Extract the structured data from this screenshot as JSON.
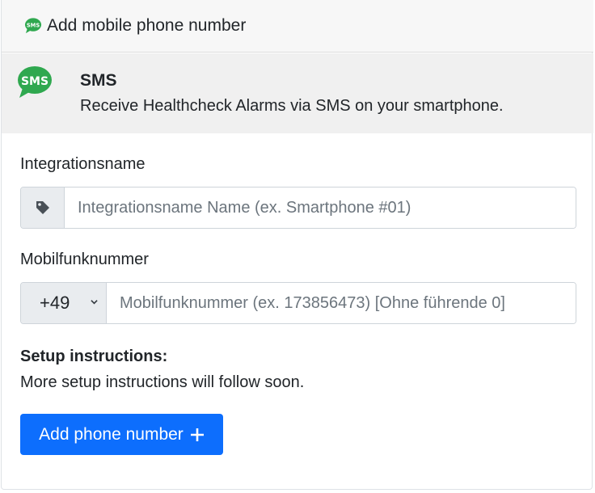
{
  "header": {
    "title": "Add mobile phone number",
    "icon": "sms-icon"
  },
  "integration": {
    "title": "SMS",
    "description": "Receive Healthcheck Alarms via SMS on your smartphone.",
    "icon": "sms-icon",
    "icon_text": "SMS",
    "icon_color": "#2fa84f"
  },
  "form": {
    "name_label": "Integrationsname",
    "name_placeholder": "Integrationsname Name (ex. Smartphone #01)",
    "name_icon": "tag-icon",
    "phone_label": "Mobilfunknummer",
    "country_code": "+49",
    "phone_placeholder": "Mobilfunknummer (ex. 173856473) [Ohne führende 0]"
  },
  "setup": {
    "title": "Setup instructions:",
    "text": "More setup instructions will follow soon."
  },
  "submit": {
    "label": "Add phone number",
    "icon": "plus-icon",
    "color": "#0d6efd"
  }
}
